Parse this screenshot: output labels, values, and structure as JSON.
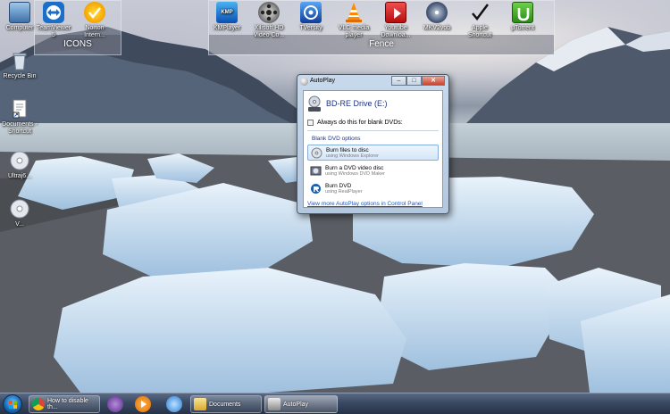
{
  "desktop": {
    "fences": [
      {
        "title": "ICONS"
      },
      {
        "title": "Fence"
      }
    ],
    "icons_left_fence": [
      {
        "label": "Computer",
        "icon": "computer-icon"
      },
      {
        "label": "TeamViewer 5",
        "icon": "teamviewer-icon"
      },
      {
        "label": "Norton Intern...",
        "icon": "norton-icon"
      }
    ],
    "icons_right_fence": [
      {
        "label": "KMPlayer",
        "icon": "kmplayer-icon"
      },
      {
        "label": "Xilisoft HD Video Co...",
        "icon": "film-reel-icon"
      },
      {
        "label": "TVersity",
        "icon": "tversity-icon"
      },
      {
        "label": "VLC media player",
        "icon": "vlc-cone-icon"
      },
      {
        "label": "Youtube Downloa...",
        "icon": "youtube-downloader-icon"
      },
      {
        "label": "MKV2vob",
        "icon": "mkv2vob-icon"
      },
      {
        "label": "Apple Shortcut",
        "icon": "apple-shortcut-icon"
      },
      {
        "label": "μTorrent",
        "icon": "utorrent-icon"
      }
    ],
    "icons_loose": [
      {
        "label": "Recycle Bin",
        "icon": "recycle-bin-icon"
      },
      {
        "label": "Documents - Shortcut",
        "icon": "documents-shortcut-icon"
      },
      {
        "label": "Ultraj6...",
        "icon": "disc-icon"
      },
      {
        "label": "V...",
        "icon": "disc-icon-2"
      }
    ]
  },
  "autoplay": {
    "window_title": "AutoPlay",
    "controls": {
      "minimize": "–",
      "maximize": "□",
      "close": "✕"
    },
    "drive_title": "BD-RE Drive (E:)",
    "always_checkbox_label": "Always do this for blank DVDs:",
    "section_label": "Blank DVD options",
    "options": [
      {
        "title": "Burn files to disc",
        "subtitle": "using Windows Explorer",
        "icon": "burn-disc-icon"
      },
      {
        "title": "Burn a DVD video disc",
        "subtitle": "using Windows DVD Maker",
        "icon": "dvd-maker-icon"
      },
      {
        "title": "Burn DVD",
        "subtitle": "using RealPlayer",
        "icon": "realplayer-icon"
      }
    ],
    "more_link": "View more AutoPlay options in Control Panel"
  },
  "taskbar": {
    "buttons": [
      {
        "label": "How to disable th...",
        "icon": "chrome-icon"
      },
      {
        "label": "Documents",
        "icon": "folder-icon"
      },
      {
        "label": "AutoPlay",
        "icon": "autoplay-icon"
      }
    ],
    "pinned": [
      "kmplayer-pin-icon",
      "media-player-pin-icon",
      "network-pin-icon"
    ]
  },
  "colors": {
    "window_frame": "#b3c7de",
    "link": "#1b55c0",
    "heading": "#1e3287",
    "taskbar": "#3a4962"
  }
}
